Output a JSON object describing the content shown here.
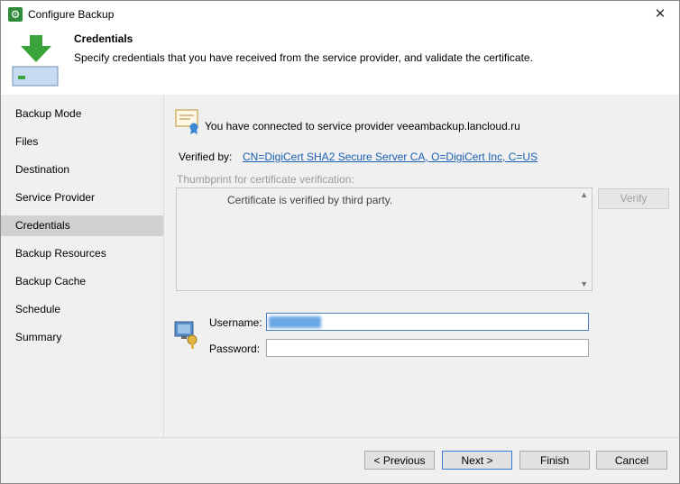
{
  "window": {
    "title": "Configure Backup"
  },
  "header": {
    "title": "Credentials",
    "description": "Specify credentials that you have received from the service provider, and validate the certificate."
  },
  "nav": {
    "items": [
      {
        "label": "Backup Mode"
      },
      {
        "label": "Files"
      },
      {
        "label": "Destination"
      },
      {
        "label": "Service Provider"
      },
      {
        "label": "Credentials",
        "active": true
      },
      {
        "label": "Backup Resources"
      },
      {
        "label": "Backup Cache"
      },
      {
        "label": "Schedule"
      },
      {
        "label": "Summary"
      }
    ]
  },
  "content": {
    "connected_text": "You have connected to service provider veeambackup.lancloud.ru",
    "verified_label": "Verified by:",
    "verified_link": "CN=DigiCert SHA2 Secure Server CA, O=DigiCert Inc, C=US",
    "thumbprint_label": "Thumbprint for certificate verification:",
    "thumbprint_text": "Certificate is verified by third party.",
    "verify_button": "Verify",
    "username_label": "Username:",
    "password_label": "Password:"
  },
  "footer": {
    "previous": "< Previous",
    "next": "Next >",
    "finish": "Finish",
    "cancel": "Cancel"
  },
  "colors": {
    "accent": "#3b7bd6",
    "link": "#1a5fb4",
    "app_icon": "#2e8b3a",
    "nav_active": "#d1d1d1"
  }
}
